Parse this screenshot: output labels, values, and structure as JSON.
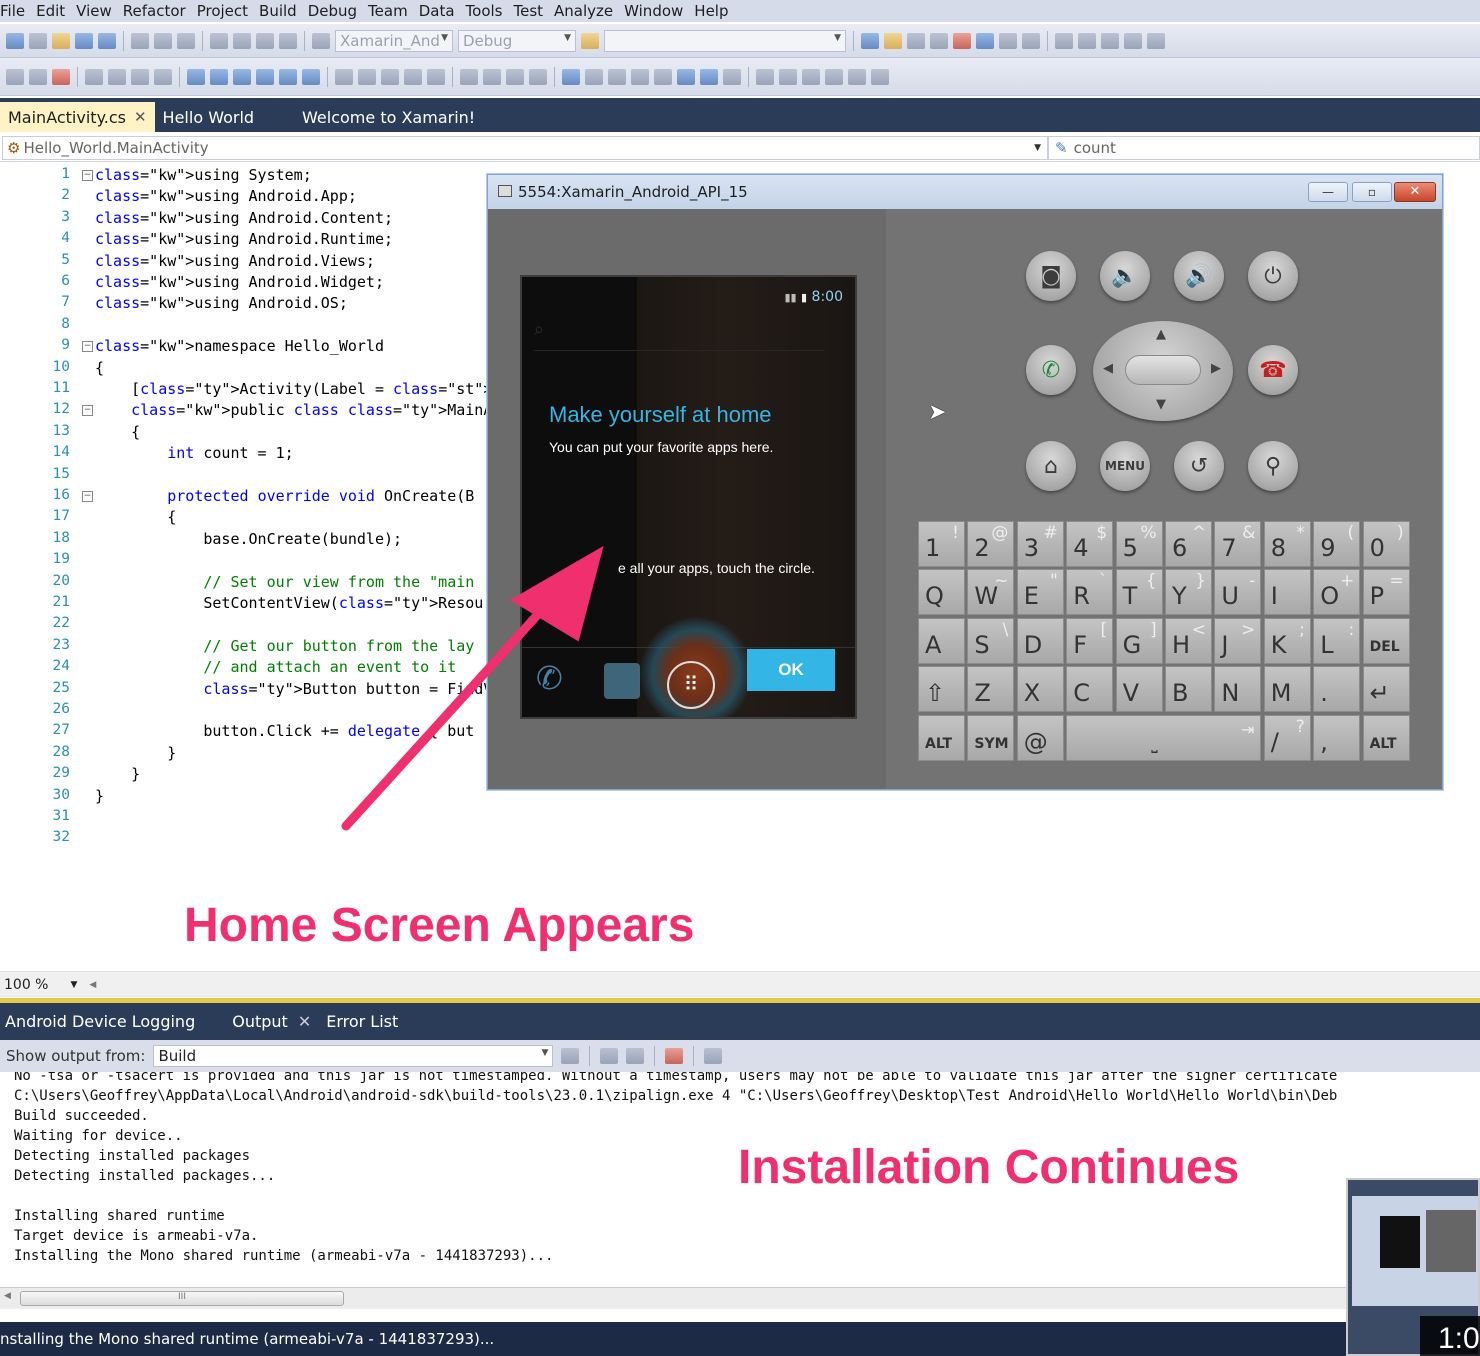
{
  "menu": [
    "File",
    "Edit",
    "View",
    "Refactor",
    "Project",
    "Build",
    "Debug",
    "Team",
    "Data",
    "Tools",
    "Test",
    "Analyze",
    "Window",
    "Help"
  ],
  "toolbar": {
    "target_device": "Xamarin_And",
    "configuration": "Debug",
    "search": ""
  },
  "tabs": [
    {
      "label": "MainActivity.cs",
      "active": true
    },
    {
      "label": "Hello World",
      "active": false
    },
    {
      "label": "Welcome to Xamarin!",
      "active": false
    }
  ],
  "navbar": {
    "type": "Hello_World.MainActivity",
    "member": "count"
  },
  "code": {
    "line_numbers": [
      "1",
      "2",
      "3",
      "4",
      "5",
      "6",
      "7",
      "8",
      "9",
      "10",
      "11",
      "12",
      "13",
      "14",
      "15",
      "16",
      "17",
      "18",
      "19",
      "20",
      "21",
      "22",
      "23",
      "24",
      "25",
      "26",
      "27",
      "28",
      "29",
      "30",
      "31",
      "32"
    ],
    "l1": "using System;",
    "l2": "using Android.App;",
    "l3": "using Android.Content;",
    "l4": "using Android.Runtime;",
    "l5": "using Android.Views;",
    "l6": "using Android.Widget;",
    "l7": "using Android.OS;",
    "l9": "namespace Hello_World",
    "l10": "{",
    "l11": "    [Activity(Label = \"Hello_World\", MainL",
    "l12": "    public class MainActivity : Activity",
    "l13": "    {",
    "l14": "        int count = 1;",
    "l16": "        protected override void OnCreate(B",
    "l17": "        {",
    "l18": "            base.OnCreate(bundle);",
    "l20": "            // Set our view from the \"main",
    "l21": "            SetContentView(Resource.Layout",
    "l23": "            // Get our button from the lay",
    "l24": "            // and attach an event to it",
    "l25": "            Button button = FindViewById",
    "l27": "            button.Click += delegate { but",
    "l28": "        }",
    "l29": "    }",
    "l30": "}"
  },
  "zoom": "100 %",
  "emulator": {
    "title": "5554:Xamarin_Android_API_15",
    "time": "8:00",
    "heading": "Make yourself at home",
    "subheading": "You can put your favorite apps here.",
    "hint": "e all your apps, touch the circle.",
    "ok": "OK",
    "menu_key": "MENU"
  },
  "keyboard": {
    "row1": [
      [
        "1",
        "!"
      ],
      [
        "2",
        "@"
      ],
      [
        "3",
        "#"
      ],
      [
        "4",
        "$"
      ],
      [
        "5",
        "%"
      ],
      [
        "6",
        "^"
      ],
      [
        "7",
        "&"
      ],
      [
        "8",
        "*"
      ],
      [
        "9",
        "("
      ],
      [
        "0",
        ")"
      ]
    ],
    "row2": [
      [
        "Q",
        ""
      ],
      [
        "W",
        "~"
      ],
      [
        "E",
        "\""
      ],
      [
        "R",
        "`"
      ],
      [
        "T",
        "{"
      ],
      [
        "Y",
        "}"
      ],
      [
        "U",
        "-"
      ],
      [
        "I",
        ""
      ],
      [
        "O",
        "+"
      ],
      [
        "P",
        "="
      ]
    ],
    "row3": [
      [
        "A",
        ""
      ],
      [
        "S",
        "\\"
      ],
      [
        "D",
        ""
      ],
      [
        "F",
        "["
      ],
      [
        "G",
        "]"
      ],
      [
        "H",
        "<"
      ],
      [
        "J",
        ">"
      ],
      [
        "K",
        ";"
      ],
      [
        "L",
        ":"
      ],
      [
        "DEL",
        ""
      ]
    ],
    "row4": [
      [
        "⇧",
        ""
      ],
      [
        "Z",
        ""
      ],
      [
        "X",
        ""
      ],
      [
        "C",
        ""
      ],
      [
        "V",
        ""
      ],
      [
        "B",
        ""
      ],
      [
        "N",
        ""
      ],
      [
        "M",
        ""
      ],
      [
        ".",
        ""
      ],
      [
        "↵",
        ""
      ]
    ],
    "row5": [
      [
        "ALT",
        ""
      ],
      [
        "SYM",
        ""
      ],
      [
        "@",
        ""
      ],
      [
        "",
        ""
      ],
      [
        "/",
        "?"
      ],
      [
        ",",
        ""
      ],
      [
        "ALT",
        ""
      ]
    ]
  },
  "annotations": {
    "home": "Home Screen Appears",
    "install": "Installation Continues"
  },
  "output": {
    "tabs": [
      "Android Device Logging",
      "Output",
      "Error List"
    ],
    "show_from_label": "Show output from:",
    "show_from_value": "Build",
    "lines": [
      "No -tsa or -tsacert is provided and this jar is not timestamped. Without a timestamp, users may not be able to validate this jar after the signer certificate",
      "C:\\Users\\Geoffrey\\AppData\\Local\\Android\\android-sdk\\build-tools\\23.0.1\\zipalign.exe 4 \"C:\\Users\\Geoffrey\\Desktop\\Test Android\\Hello World\\Hello World\\bin\\Deb",
      "Build succeeded.",
      "Waiting for device..",
      "Detecting installed packages",
      "Detecting installed packages...",
      "",
      "Installing shared runtime",
      "Target device is armeabi-v7a.",
      "Installing the Mono shared runtime (armeabi-v7a - 1441837293)..."
    ]
  },
  "status": "nstalling the Mono shared runtime (armeabi-v7a - 1441837293)...",
  "video_time": "1:0",
  "colors": {
    "annotation": "#ef2f6e",
    "tabbar": "#2b3c59",
    "active_tab": "#fff3c6",
    "emu_accent": "#33b5e5"
  }
}
